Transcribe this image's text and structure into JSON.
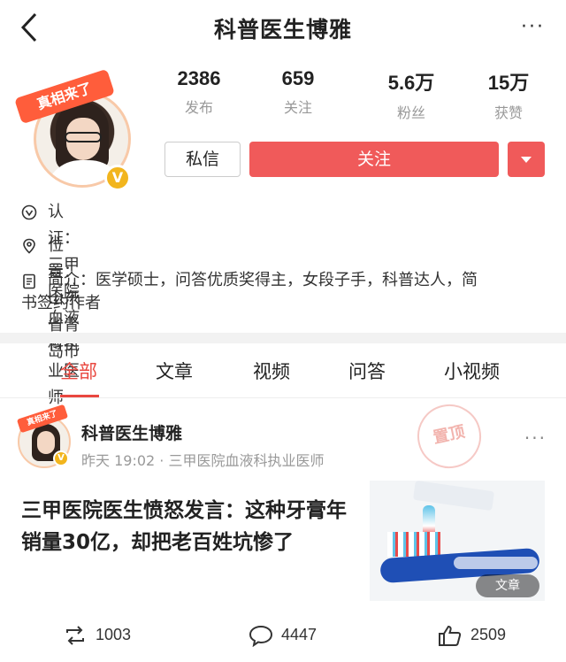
{
  "nav": {
    "title": "科普医生博雅",
    "more": "···"
  },
  "profile": {
    "banner": "真相来了",
    "verified_badge": "V",
    "stats": [
      {
        "value": "2386",
        "label": "发布"
      },
      {
        "value": "659",
        "label": "关注"
      },
      {
        "value": "5.6万",
        "label": "粉丝"
      },
      {
        "value": "15万",
        "label": "获赞"
      }
    ],
    "message_label": "私信",
    "follow_label": "关注"
  },
  "info": {
    "certification": "认证：三甲医院血液科执业医师",
    "location": "位置：山东省青岛市",
    "intro_line1": "简介：医学硕士，问答优质奖得主，女段子手，科普达人，简",
    "intro_line2": "书签约作者"
  },
  "tabs": [
    {
      "label": "全部",
      "active": true
    },
    {
      "label": "文章",
      "active": false
    },
    {
      "label": "视频",
      "active": false
    },
    {
      "label": "问答",
      "active": false
    },
    {
      "label": "小视频",
      "active": false
    }
  ],
  "feed": {
    "author": "科普医生博雅",
    "meta": "昨天 19:02 · 三甲医院血液科执业医师",
    "stamp": "置顶",
    "headline": "三甲医院医生愤怒发言：这种牙膏年销量30亿，却把老百姓坑惨了",
    "thumb_tag": "文章",
    "reposts": "1003",
    "comments": "4447",
    "likes": "2509"
  },
  "colors": {
    "accent": "#f05a5a",
    "active_tab": "#e9473f",
    "muted": "#999999"
  }
}
